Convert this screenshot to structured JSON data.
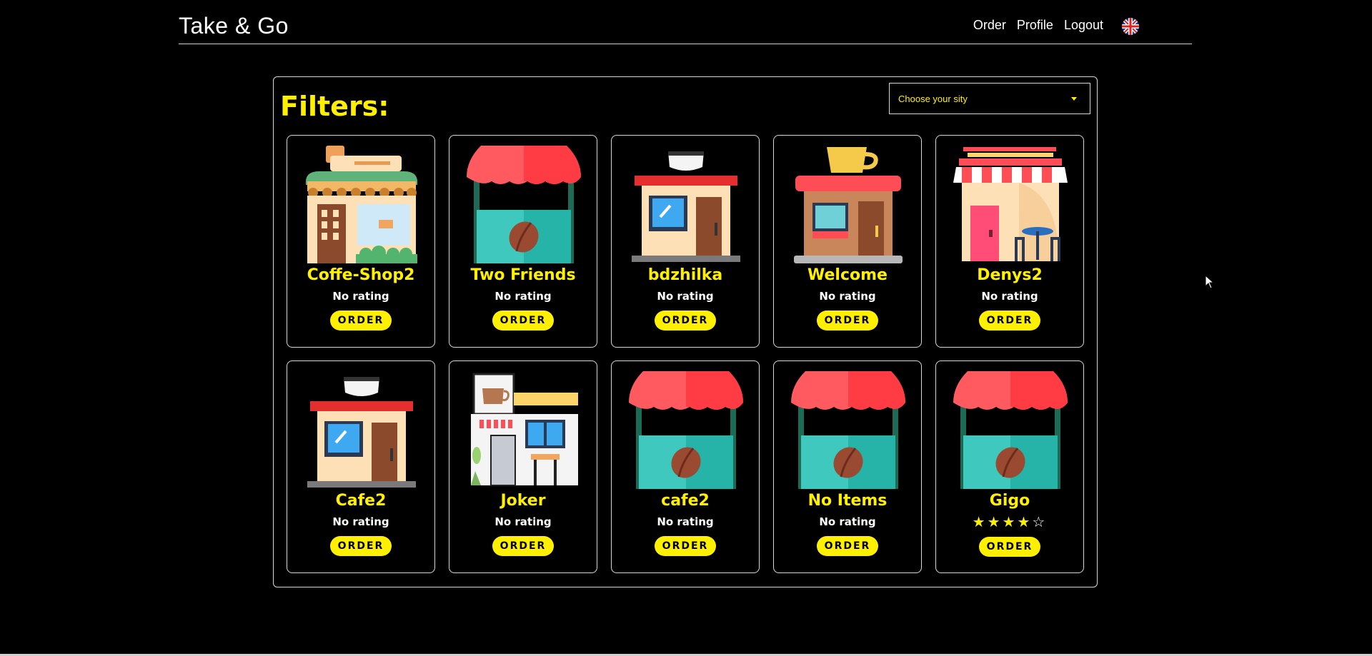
{
  "header": {
    "brand": "Take & Go",
    "nav": [
      "Order",
      "Profile",
      "Logout"
    ],
    "language_icon": "uk-flag-icon"
  },
  "filters": {
    "title": "Filters:",
    "city_select": {
      "selected": "Choose your sity"
    }
  },
  "shops": [
    {
      "name": "Coffe-Shop2",
      "rating_text": "No rating",
      "order_label": "ORDER",
      "icon": "cafe-building-icon"
    },
    {
      "name": "Two Friends",
      "rating_text": "No rating",
      "order_label": "ORDER",
      "icon": "coffee-stall-icon"
    },
    {
      "name": "bdzhilka",
      "rating_text": "No rating",
      "order_label": "ORDER",
      "icon": "coffee-kiosk-icon"
    },
    {
      "name": "Welcome",
      "rating_text": "No rating",
      "order_label": "ORDER",
      "icon": "coffee-shop-cup-icon"
    },
    {
      "name": "Denys2",
      "rating_text": "No rating",
      "order_label": "ORDER",
      "icon": "striped-awning-cafe-icon"
    },
    {
      "name": "Cafe2",
      "rating_text": "No rating",
      "order_label": "ORDER",
      "icon": "coffee-kiosk-icon"
    },
    {
      "name": "Joker",
      "rating_text": "No rating",
      "order_label": "ORDER",
      "icon": "coffee-storefront-icon"
    },
    {
      "name": "cafe2",
      "rating_text": "No rating",
      "order_label": "ORDER",
      "icon": "coffee-stall-icon"
    },
    {
      "name": "No Items",
      "rating_text": "No rating",
      "order_label": "ORDER",
      "icon": "coffee-stall-icon"
    },
    {
      "name": "Gigo",
      "rating_stars": 4,
      "rating_max": 5,
      "order_label": "ORDER",
      "icon": "coffee-stall-icon"
    }
  ],
  "colors": {
    "accent": "#fff000",
    "background": "#000000",
    "stall_awning": "#ff5a5f",
    "stall_body": "#3fc9be"
  }
}
